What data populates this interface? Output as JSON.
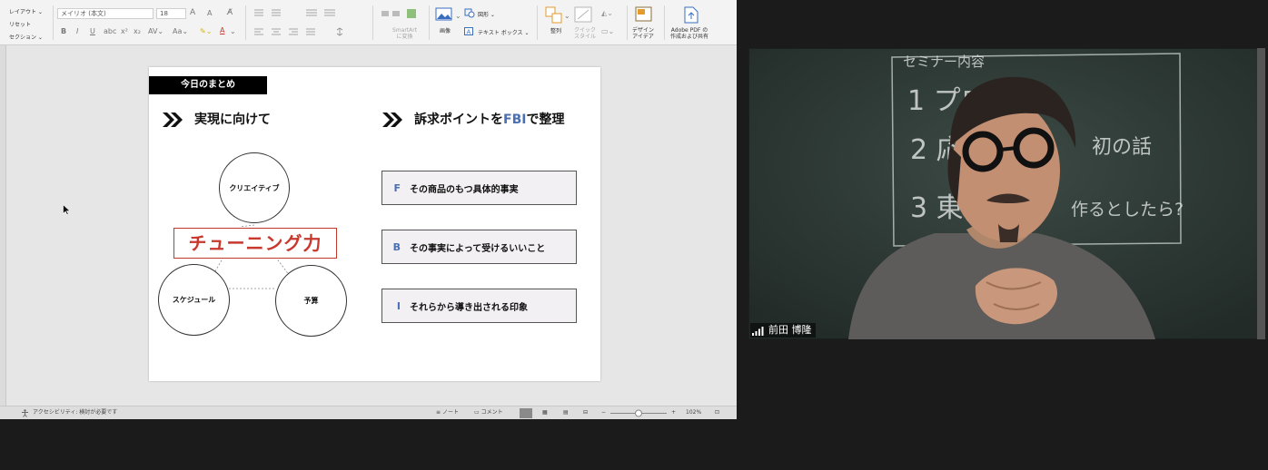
{
  "ribbon": {
    "layout_label": "レイアウト",
    "reset_label": "リセット",
    "section_label": "セクション",
    "font_name": "メイリオ (本文)",
    "font_size": "18",
    "smartart_label_1": "SmartArt",
    "smartart_label_2": "に変換",
    "picture_label": "画像",
    "shapes_label": "図形",
    "textbox_label": "テキスト ボックス",
    "arrange_label": "整列",
    "quick_styles_label_1": "クイック",
    "quick_styles_label_2": "スタイル",
    "design_ideas_label_1": "デザイン",
    "design_ideas_label_2": "アイデア",
    "adobe_label_1": "Adobe PDF の",
    "adobe_label_2": "作成および共有"
  },
  "slide": {
    "tag": "今日のまとめ",
    "left_heading": "実現に向けて",
    "right_heading_pre": "訴求ポイントを",
    "right_heading_accent": "FBI",
    "right_heading_post": "で整理",
    "circles": {
      "top": "クリエイティブ",
      "bottom_left": "スケジュール",
      "bottom_right": "予算"
    },
    "center_label": "チューニング力",
    "fbi": [
      {
        "letter": "F",
        "text": "その商品のもつ具体的事実"
      },
      {
        "letter": "B",
        "text": "その事実によって受けるいいこと"
      },
      {
        "letter": "I",
        "text": "それらから導き出される印象"
      }
    ],
    "accent_color": "#4a6fb3",
    "center_color": "#c8382d"
  },
  "statusbar": {
    "accessibility": "アクセシビリティ: 検討が必要です",
    "notes": "ノート",
    "comments": "コメント",
    "zoom": "102%"
  },
  "video": {
    "participant_name": "前田 博隆",
    "board_lines": [
      "セミナー内容",
      "1 プロ",
      "2 応",
      "初の話",
      "3 東",
      "作るとしたら?"
    ]
  }
}
